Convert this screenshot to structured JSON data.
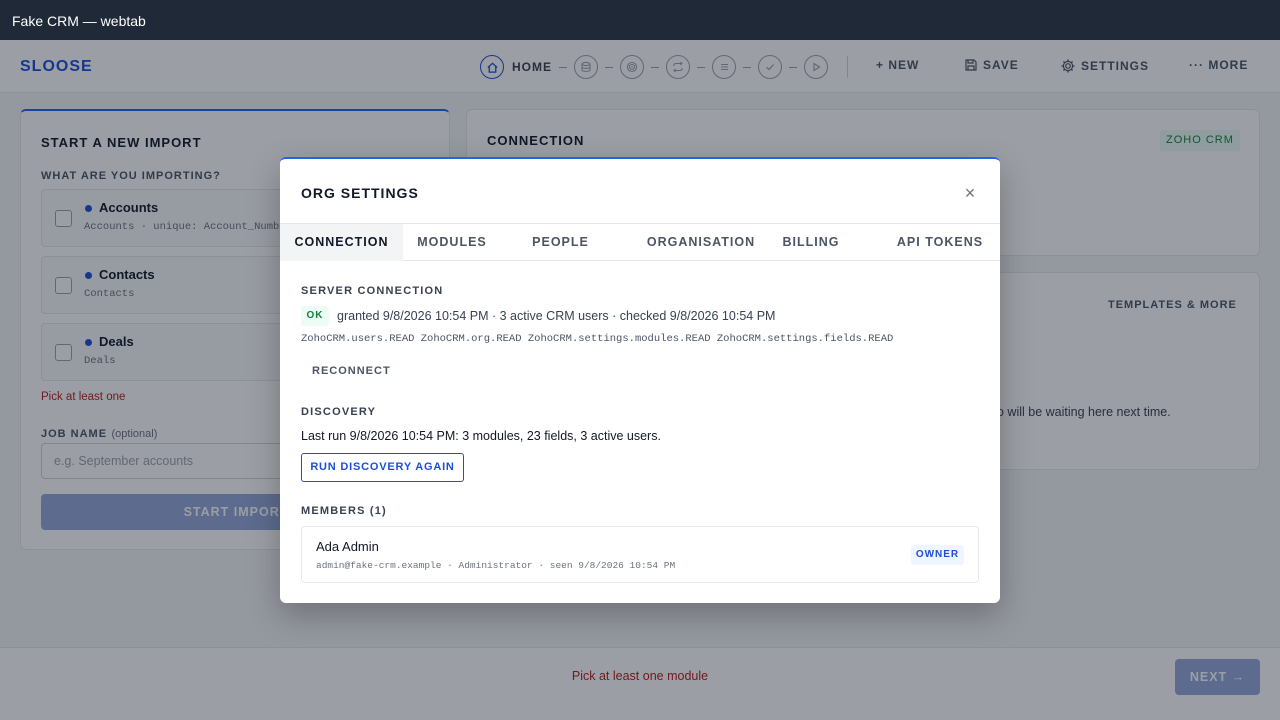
{
  "window": {
    "title": "Fake CRM — webtab"
  },
  "header": {
    "brand": "SLOOSE",
    "steps": [
      {
        "label": "HOME",
        "icon": "home-icon",
        "active": true
      },
      {
        "icon": "database-icon"
      },
      {
        "icon": "target-icon"
      },
      {
        "icon": "swap-icon"
      },
      {
        "icon": "list-icon"
      },
      {
        "icon": "check-icon"
      },
      {
        "icon": "play-icon"
      }
    ],
    "actions": {
      "new": "+ NEW",
      "save": "SAVE",
      "settings": "SETTINGS",
      "more": "··· MORE"
    }
  },
  "import_card": {
    "title": "START A NEW IMPORT",
    "question": "WHAT ARE YOU IMPORTING?",
    "modules": [
      {
        "name": "Accounts",
        "sub": "Accounts · unique: Account_Number"
      },
      {
        "name": "Contacts",
        "sub": "Contacts"
      },
      {
        "name": "Deals",
        "sub": "Deals"
      }
    ],
    "error": "Pick at least one",
    "job_name_label": "JOB NAME",
    "job_name_optional": "(optional)",
    "job_name_placeholder": "e.g. September accounts",
    "start_button": "START IMPORT"
  },
  "connection_card": {
    "title": "CONNECTION",
    "badge": "ZOHO CRM"
  },
  "templates_card": {
    "link": "TEMPLATES & MORE",
    "text_fragment": "o will be waiting here next time."
  },
  "footer": {
    "message": "Pick at least one module",
    "next_button": "NEXT →"
  },
  "modal": {
    "title": "ORG SETTINGS",
    "close": "×",
    "tabs": [
      "CONNECTION",
      "MODULES",
      "PEOPLE",
      "ORGANISATION",
      "BILLING",
      "API TOKENS"
    ],
    "server": {
      "label": "SERVER CONNECTION",
      "status": "OK",
      "status_text": "granted 9/8/2026 10:54 PM · 3 active CRM users · checked 9/8/2026 10:54 PM",
      "scopes": "ZohoCRM.users.READ ZohoCRM.org.READ ZohoCRM.settings.modules.READ ZohoCRM.settings.fields.READ",
      "reconnect": "RECONNECT"
    },
    "discovery": {
      "label": "DISCOVERY",
      "text": "Last run 9/8/2026 10:54 PM: 3 modules, 23 fields, 3 active users.",
      "button": "RUN DISCOVERY AGAIN"
    },
    "members": {
      "label": "MEMBERS (1)",
      "items": [
        {
          "name": "Ada Admin",
          "meta": "admin@fake-crm.example · Administrator · seen 9/8/2026 10:54 PM",
          "role": "OWNER"
        }
      ]
    }
  },
  "colors": {
    "accent": "#1d4ed8",
    "titlebar": "#1f2937",
    "ok_green": "#15803d",
    "error_red": "#b91c1c"
  }
}
